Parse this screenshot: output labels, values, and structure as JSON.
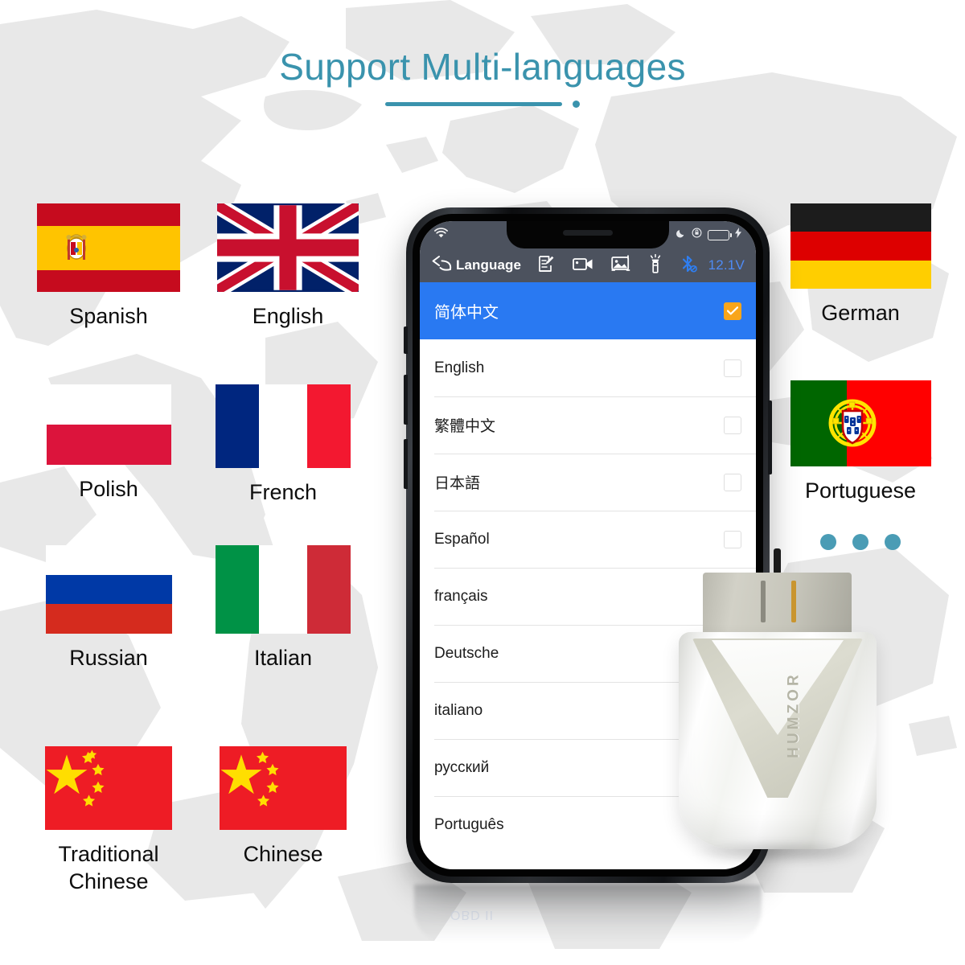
{
  "header": {
    "title": "Support Multi-languages",
    "accent_color": "#3a93ad"
  },
  "flags": [
    {
      "id": "spain",
      "label": "Spanish",
      "icon": "flag-spain-icon"
    },
    {
      "id": "uk",
      "label": "English",
      "icon": "flag-uk-icon"
    },
    {
      "id": "germany",
      "label": "German",
      "icon": "flag-germany-icon"
    },
    {
      "id": "poland",
      "label": "Polish",
      "icon": "flag-poland-icon"
    },
    {
      "id": "france",
      "label": "French",
      "icon": "flag-france-icon"
    },
    {
      "id": "portugal",
      "label": "Portuguese",
      "icon": "flag-portugal-icon"
    },
    {
      "id": "russia",
      "label": "Russian",
      "icon": "flag-russia-icon"
    },
    {
      "id": "italy",
      "label": "Italian",
      "icon": "flag-italy-icon"
    },
    {
      "id": "china-trad",
      "label": "Traditional\nChinese",
      "icon": "flag-china-icon"
    },
    {
      "id": "china",
      "label": "Chinese",
      "icon": "flag-china-icon"
    }
  ],
  "phone": {
    "statusbar": {
      "wifi_icon": "wifi-icon",
      "moon_icon": "moon-icon",
      "rotation_lock_icon": "rotation-lock-icon",
      "battery_icon": "battery-icon",
      "charging_icon": "lightning-bolt-icon"
    },
    "toolbar": {
      "back_icon": "back-arrow-icon",
      "title": "Language",
      "icons": [
        {
          "name": "note-edit-icon"
        },
        {
          "name": "video-camera-icon"
        },
        {
          "name": "image-gallery-icon"
        },
        {
          "name": "flashlight-icon"
        },
        {
          "name": "bluetooth-icon"
        }
      ],
      "voltage": "12.1V",
      "voltage_color": "#4e8bf5"
    },
    "languages": [
      {
        "name": "简体中文",
        "selected": true
      },
      {
        "name": "English",
        "selected": false
      },
      {
        "name": "繁體中文",
        "selected": false
      },
      {
        "name": "日本語",
        "selected": false
      },
      {
        "name": "Español",
        "selected": false
      },
      {
        "name": "français",
        "selected": false
      },
      {
        "name": "Deutsche",
        "selected": false
      },
      {
        "name": "italiano",
        "selected": false
      },
      {
        "name": "русский",
        "selected": false
      },
      {
        "name": "Português",
        "selected": false
      }
    ],
    "selected_color": "#2979f2",
    "checkbox_on_color": "#f9a51a",
    "reflection_text": "OBD II"
  },
  "device": {
    "brand": "HUMZOR",
    "icon": "obd-dongle-icon"
  },
  "pagination": {
    "dots": 3,
    "color": "#4a9cb5"
  }
}
